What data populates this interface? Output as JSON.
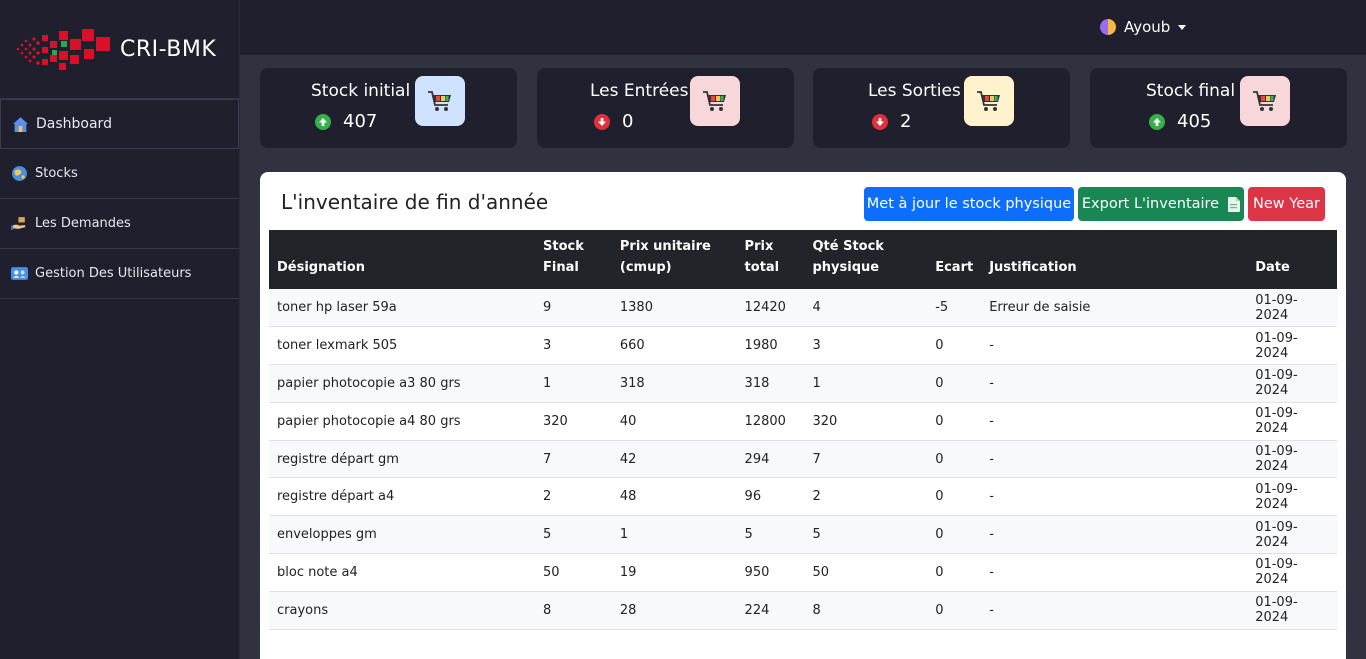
{
  "brand": {
    "name": "CRI-BMK"
  },
  "user": {
    "name": "Ayoub"
  },
  "sidebar": {
    "items": [
      {
        "label": "Dashboard",
        "icon": "home-icon"
      },
      {
        "label": "Stocks",
        "icon": "globe-icon"
      },
      {
        "label": "Les Demandes",
        "icon": "hand-box-icon"
      },
      {
        "label": "Gestion Des Utilisateurs",
        "icon": "users-icon"
      }
    ]
  },
  "cards": [
    {
      "title": "Stock initial",
      "value": "407",
      "trend": "up",
      "icon": "cart-icon",
      "icon_bg": "#cfe2ff"
    },
    {
      "title": "Les Entrées",
      "value": "0",
      "trend": "down",
      "icon": "cart-icon",
      "icon_bg": "#f8d7da"
    },
    {
      "title": "Les Sorties",
      "value": "2",
      "trend": "down",
      "icon": "cart-icon",
      "icon_bg": "#fff3cd"
    },
    {
      "title": "Stock final",
      "value": "405",
      "trend": "up",
      "icon": "cart-icon",
      "icon_bg": "#f8d7da"
    }
  ],
  "panel": {
    "title": "L'inventaire de fin d'année",
    "buttons": {
      "update": "Met à jour le stock physique",
      "export": "Export L'inventaire",
      "new_year": "New Year"
    }
  },
  "table": {
    "headers": [
      "Désignation",
      "Stock Final",
      "Prix unitaire (cmup)",
      "Prix total",
      "Qté Stock physique",
      "Ecart",
      "Justification",
      "Date"
    ],
    "rows": [
      [
        "toner hp laser 59a",
        "9",
        "1380",
        "12420",
        "4",
        "-5",
        "Erreur de saisie",
        "01-09-2024"
      ],
      [
        "toner lexmark 505",
        "3",
        "660",
        "1980",
        "3",
        "0",
        "-",
        "01-09-2024"
      ],
      [
        "papier photocopie a3 80 grs",
        "1",
        "318",
        "318",
        "1",
        "0",
        "-",
        "01-09-2024"
      ],
      [
        "papier photocopie a4 80 grs",
        "320",
        "40",
        "12800",
        "320",
        "0",
        "-",
        "01-09-2024"
      ],
      [
        "registre départ gm",
        "7",
        "42",
        "294",
        "7",
        "0",
        "-",
        "01-09-2024"
      ],
      [
        "registre départ a4",
        "2",
        "48",
        "96",
        "2",
        "0",
        "-",
        "01-09-2024"
      ],
      [
        "enveloppes gm",
        "5",
        "1",
        "5",
        "5",
        "0",
        "-",
        "01-09-2024"
      ],
      [
        "bloc note a4",
        "50",
        "19",
        "950",
        "50",
        "0",
        "-",
        "01-09-2024"
      ],
      [
        "crayons",
        "8",
        "28",
        "224",
        "8",
        "0",
        "-",
        "01-09-2024"
      ]
    ]
  },
  "colors": {
    "sidebar_bg": "#1f1f2e",
    "content_bg": "#31323f",
    "primary": "#0d6efd",
    "success": "#198754",
    "danger": "#dc3545"
  }
}
